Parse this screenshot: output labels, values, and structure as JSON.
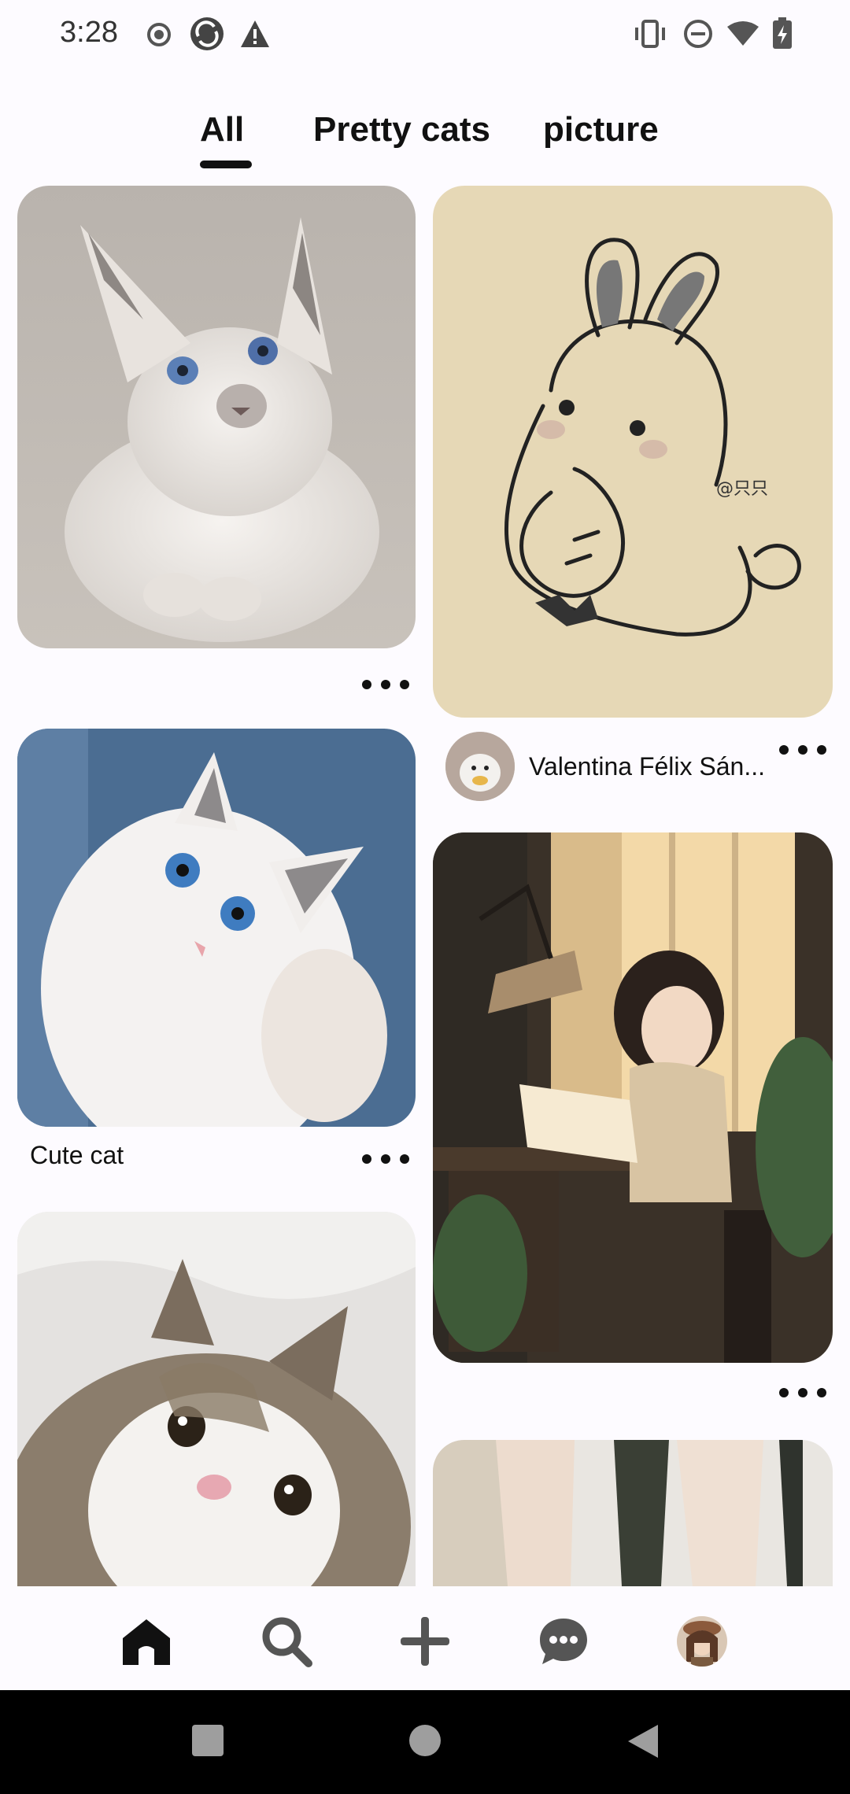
{
  "status_bar": {
    "time": "3:28",
    "left_icons": [
      "record-icon",
      "sync-icon",
      "warning-icon"
    ],
    "right_icons": [
      "vibrate-icon",
      "do-not-disturb-icon",
      "wifi-icon",
      "battery-icon"
    ]
  },
  "tabs": [
    {
      "label": "All",
      "selected": true
    },
    {
      "label": "Pretty cats",
      "selected": false
    },
    {
      "label": "picture",
      "selected": false
    }
  ],
  "pins": [
    {
      "id": "kitten-siamese",
      "image": "white kitten with blue eyes",
      "title": ""
    },
    {
      "id": "bunny-drawing",
      "image": "bunny line drawing on beige paper",
      "watermark": "@只只",
      "author": "Valentina Félix Sán..."
    },
    {
      "id": "cute-cat",
      "image": "fluffy white cat on blue fabric",
      "title": "Cute cat"
    },
    {
      "id": "girl-desk",
      "image": "anime girl reading at desk",
      "title": ""
    },
    {
      "id": "tabby-kitten",
      "image": "tabby and white kitten close up",
      "title": ""
    },
    {
      "id": "legs-photo",
      "image": "legs in beige stockings",
      "title": ""
    }
  ],
  "bottom_nav": [
    {
      "name": "home",
      "icon": "home-icon",
      "active": true
    },
    {
      "name": "search",
      "icon": "search-icon",
      "active": false
    },
    {
      "name": "create",
      "icon": "plus-icon",
      "active": false
    },
    {
      "name": "messages",
      "icon": "chat-bubble-icon",
      "active": false
    },
    {
      "name": "profile",
      "icon": "avatar",
      "active": false
    }
  ],
  "system_nav": [
    "recents-square-icon",
    "home-circle-icon",
    "back-triangle-icon"
  ],
  "colors": {
    "background": "#fdfbff",
    "text": "#111111",
    "system_nav": "#000000"
  }
}
